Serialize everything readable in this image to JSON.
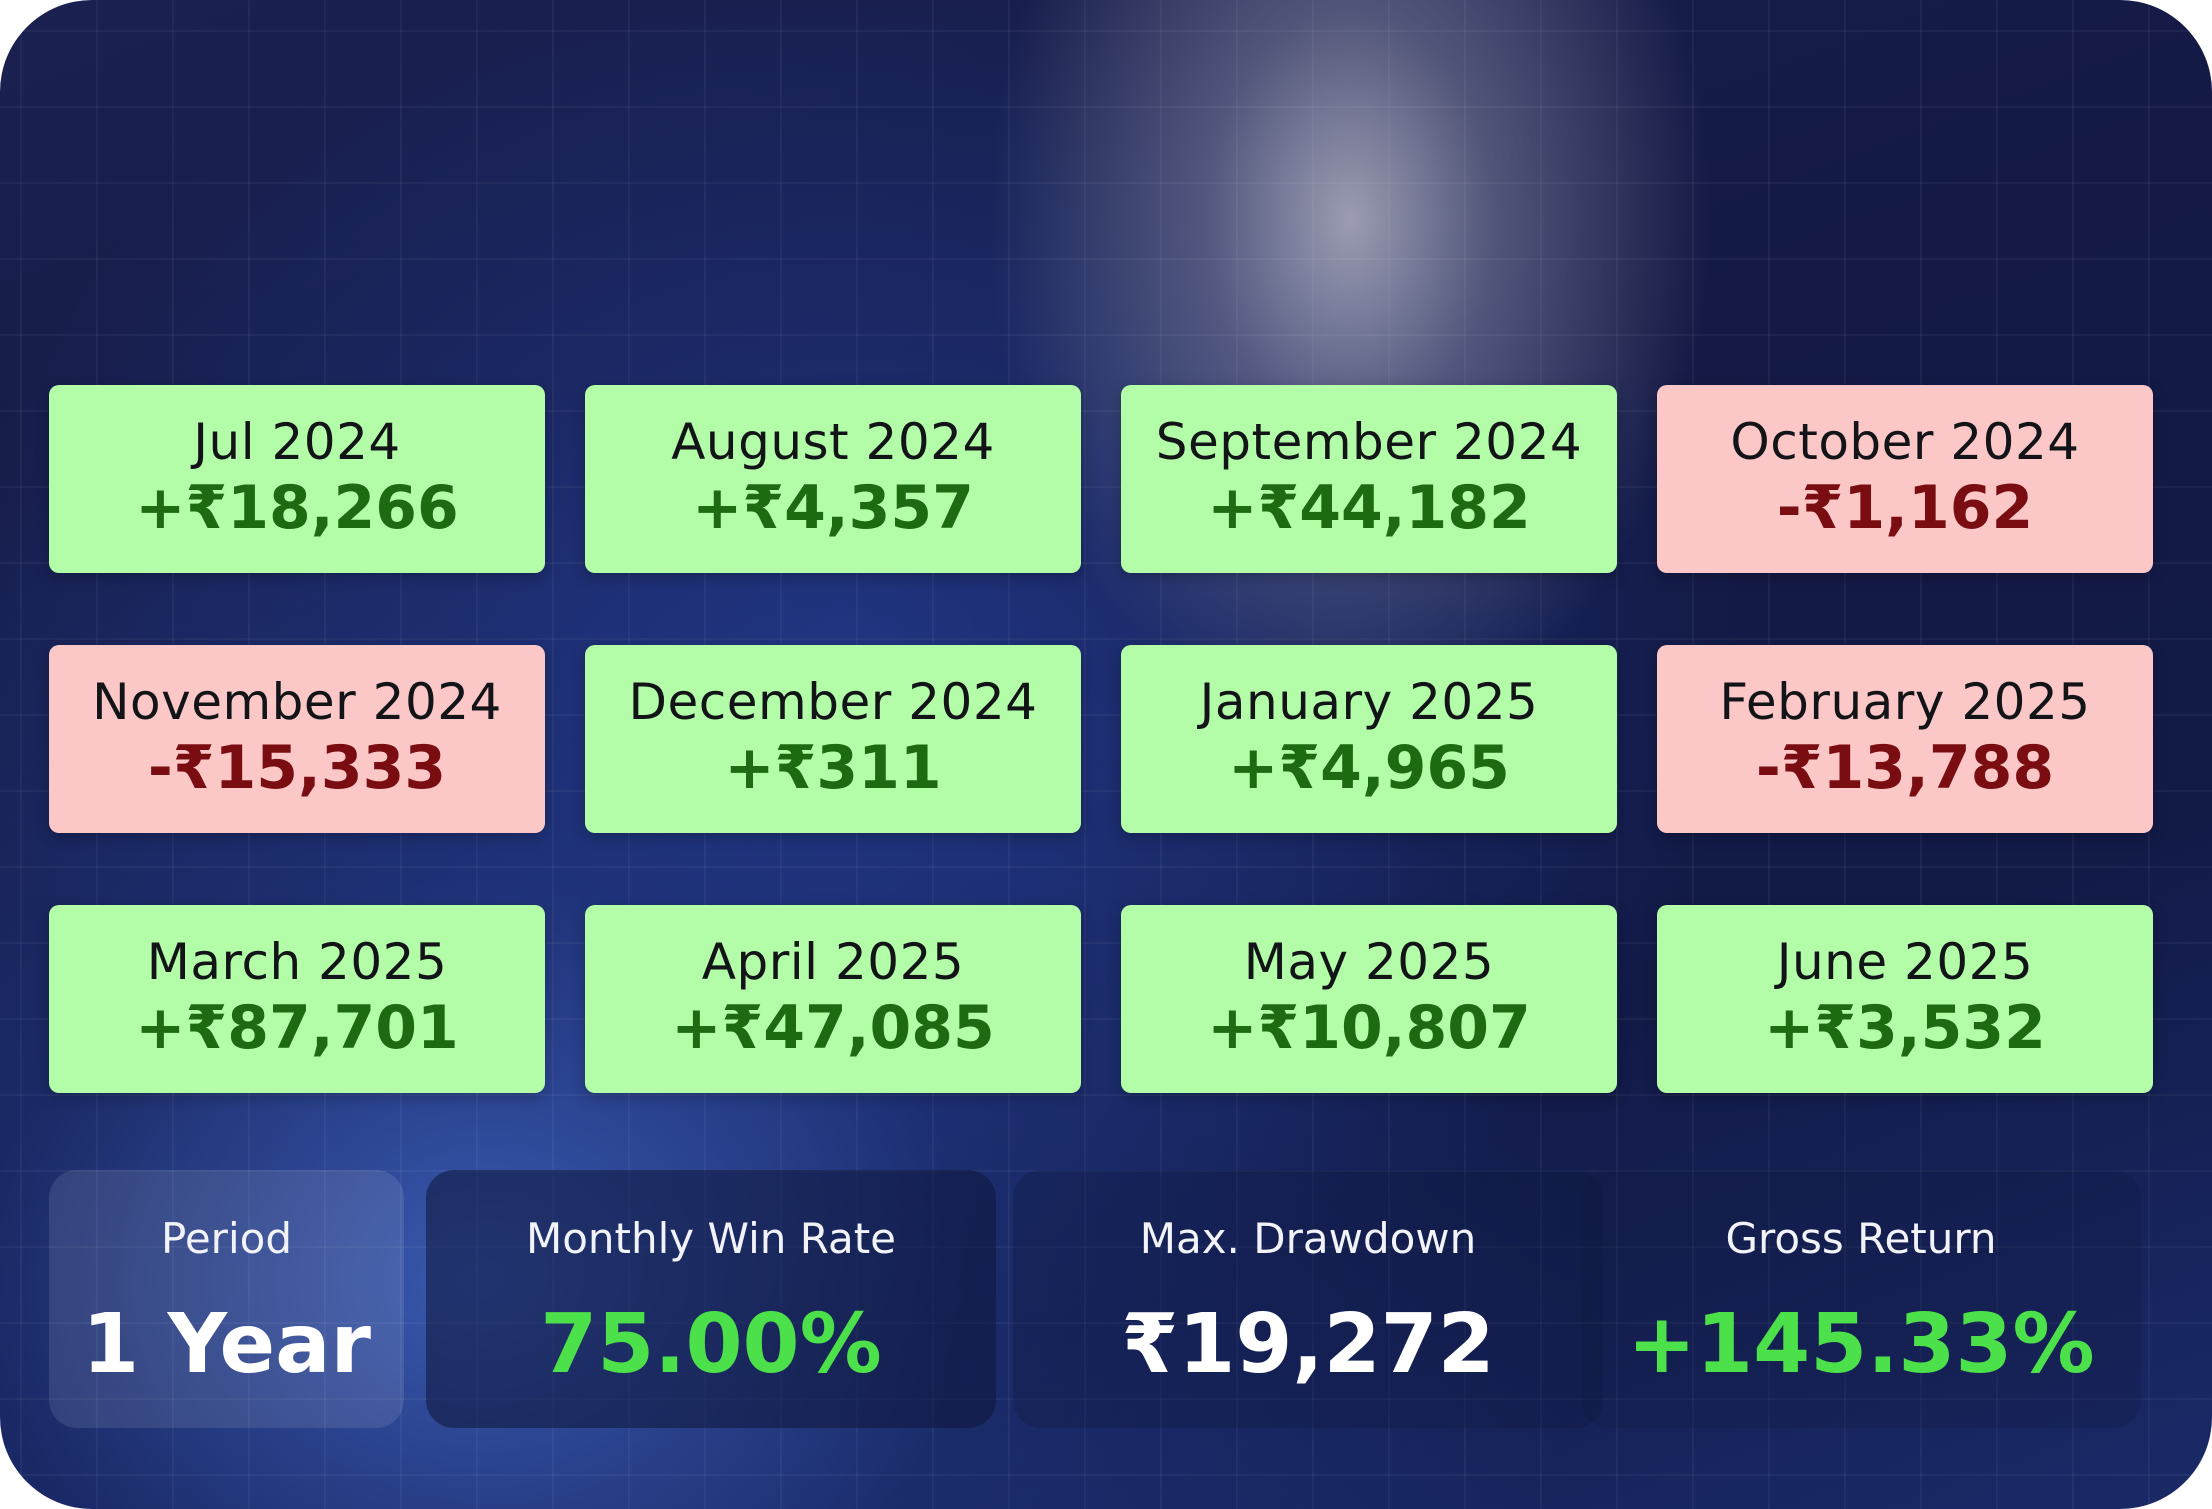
{
  "monthly_returns": [
    {
      "month": "Jul 2024",
      "amount": "+₹18,266",
      "status": "positive"
    },
    {
      "month": "August 2024",
      "amount": "+₹4,357",
      "status": "positive"
    },
    {
      "month": "September 2024",
      "amount": "+₹44,182",
      "status": "positive"
    },
    {
      "month": "October 2024",
      "amount": "-₹1,162",
      "status": "negative"
    },
    {
      "month": "November 2024",
      "amount": "-₹15,333",
      "status": "negative"
    },
    {
      "month": "December 2024",
      "amount": "+₹311",
      "status": "positive"
    },
    {
      "month": "January 2025",
      "amount": "+₹4,965",
      "status": "positive"
    },
    {
      "month": "February 2025",
      "amount": "-₹13,788",
      "status": "negative"
    },
    {
      "month": "March 2025",
      "amount": "+₹87,701",
      "status": "positive"
    },
    {
      "month": "April 2025",
      "amount": "+₹47,085",
      "status": "positive"
    },
    {
      "month": "May 2025",
      "amount": "+₹10,807",
      "status": "positive"
    },
    {
      "month": "June 2025",
      "amount": "+₹3,532",
      "status": "positive"
    }
  ],
  "stats": {
    "period": {
      "label": "Period",
      "value": "1 Year"
    },
    "win_rate": {
      "label": "Monthly Win Rate",
      "value": "75.00%"
    },
    "drawdown": {
      "label": "Max. Drawdown",
      "value": "₹19,272"
    },
    "gross_return": {
      "label": "Gross Return",
      "value": "+145.33%"
    }
  },
  "colors": {
    "positive_bg": "#b3fda9",
    "positive_text": "#1e6a12",
    "negative_bg": "#fbc7c7",
    "negative_text": "#7a0d12",
    "stat_green": "#4ce04a",
    "stat_white": "#ffffff"
  }
}
